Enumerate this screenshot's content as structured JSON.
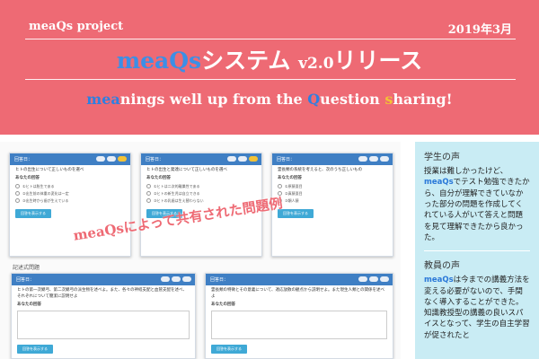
{
  "header": {
    "project": "meaQs project",
    "date": "2019年3月",
    "title_brand": "meaQs",
    "title_mid": "システム ",
    "title_version": "v2.0",
    "title_end": "リリース",
    "subtitle_parts": [
      "mea",
      "nings well up from the ",
      "Q",
      "uestion ",
      "s",
      "haring!"
    ]
  },
  "cards_top": [
    {
      "head": "回答日：",
      "question": "ヒトの出生について正しいものを選べ",
      "answer_label": "あなたの回答",
      "options": [
        "①ヒトは胎生である",
        "②出生前の体重の変化は一定",
        "③出生時から歯が生えている"
      ],
      "button": "回答を表示する"
    },
    {
      "head": "回答日：",
      "question": "ヒトの出生と発達について正しいものを選べ",
      "answer_label": "あなたの回答",
      "options": [
        "①ヒトは二次的離巣性である",
        "②ヒトの新生児は自立できる",
        "③ヒトの乳歯は生え替わらない"
      ],
      "button": "回答を表示する"
    },
    {
      "head": "回答日：",
      "question": "霊長類の系統を考えると、次のうち正しいもの",
      "answer_label": "あなたの回答",
      "options": [
        "①原猿亜目",
        "②真猿亜目",
        "③類人猿"
      ],
      "button": "回答を表示する"
    }
  ],
  "section_label": "記述式問題",
  "cards_bottom": [
    {
      "head": "回答日：",
      "question": "ヒトの第一次鰓弓、第二次鰓弓の派生物を述べよ。また、各々の神経支配と血管支配を述べ、それぞれについて簡潔に説明せよ",
      "answer_label": "あなたの回答",
      "button": "回答を表示する"
    },
    {
      "head": "回答日：",
      "question": "霊長類の特徴とその意義について、適応放散の観点から説明せよ。また現生人類との関係を述べよ",
      "answer_label": "あなたの回答",
      "button": "回答を表示する"
    }
  ],
  "stamp": "meaQsによって共有された問題例",
  "sidebar": {
    "student_title": "学生の声",
    "student_text_1": "授業は難しかったけど、",
    "student_brand": "meaQs",
    "student_text_2": "でテスト勉強できたから、自分が理解できていなかった部分の問題を作成してくれている人がいて答えと問題を見て理解できたから良かった。",
    "teacher_title": "教員の声",
    "teacher_brand": "meaQs",
    "teacher_text": "は今までの講義方法を変える必要がないので、手間なく導入することができた。知識教授型の講義の良いスパイスとなって、学生の自主学習が促されたと"
  }
}
